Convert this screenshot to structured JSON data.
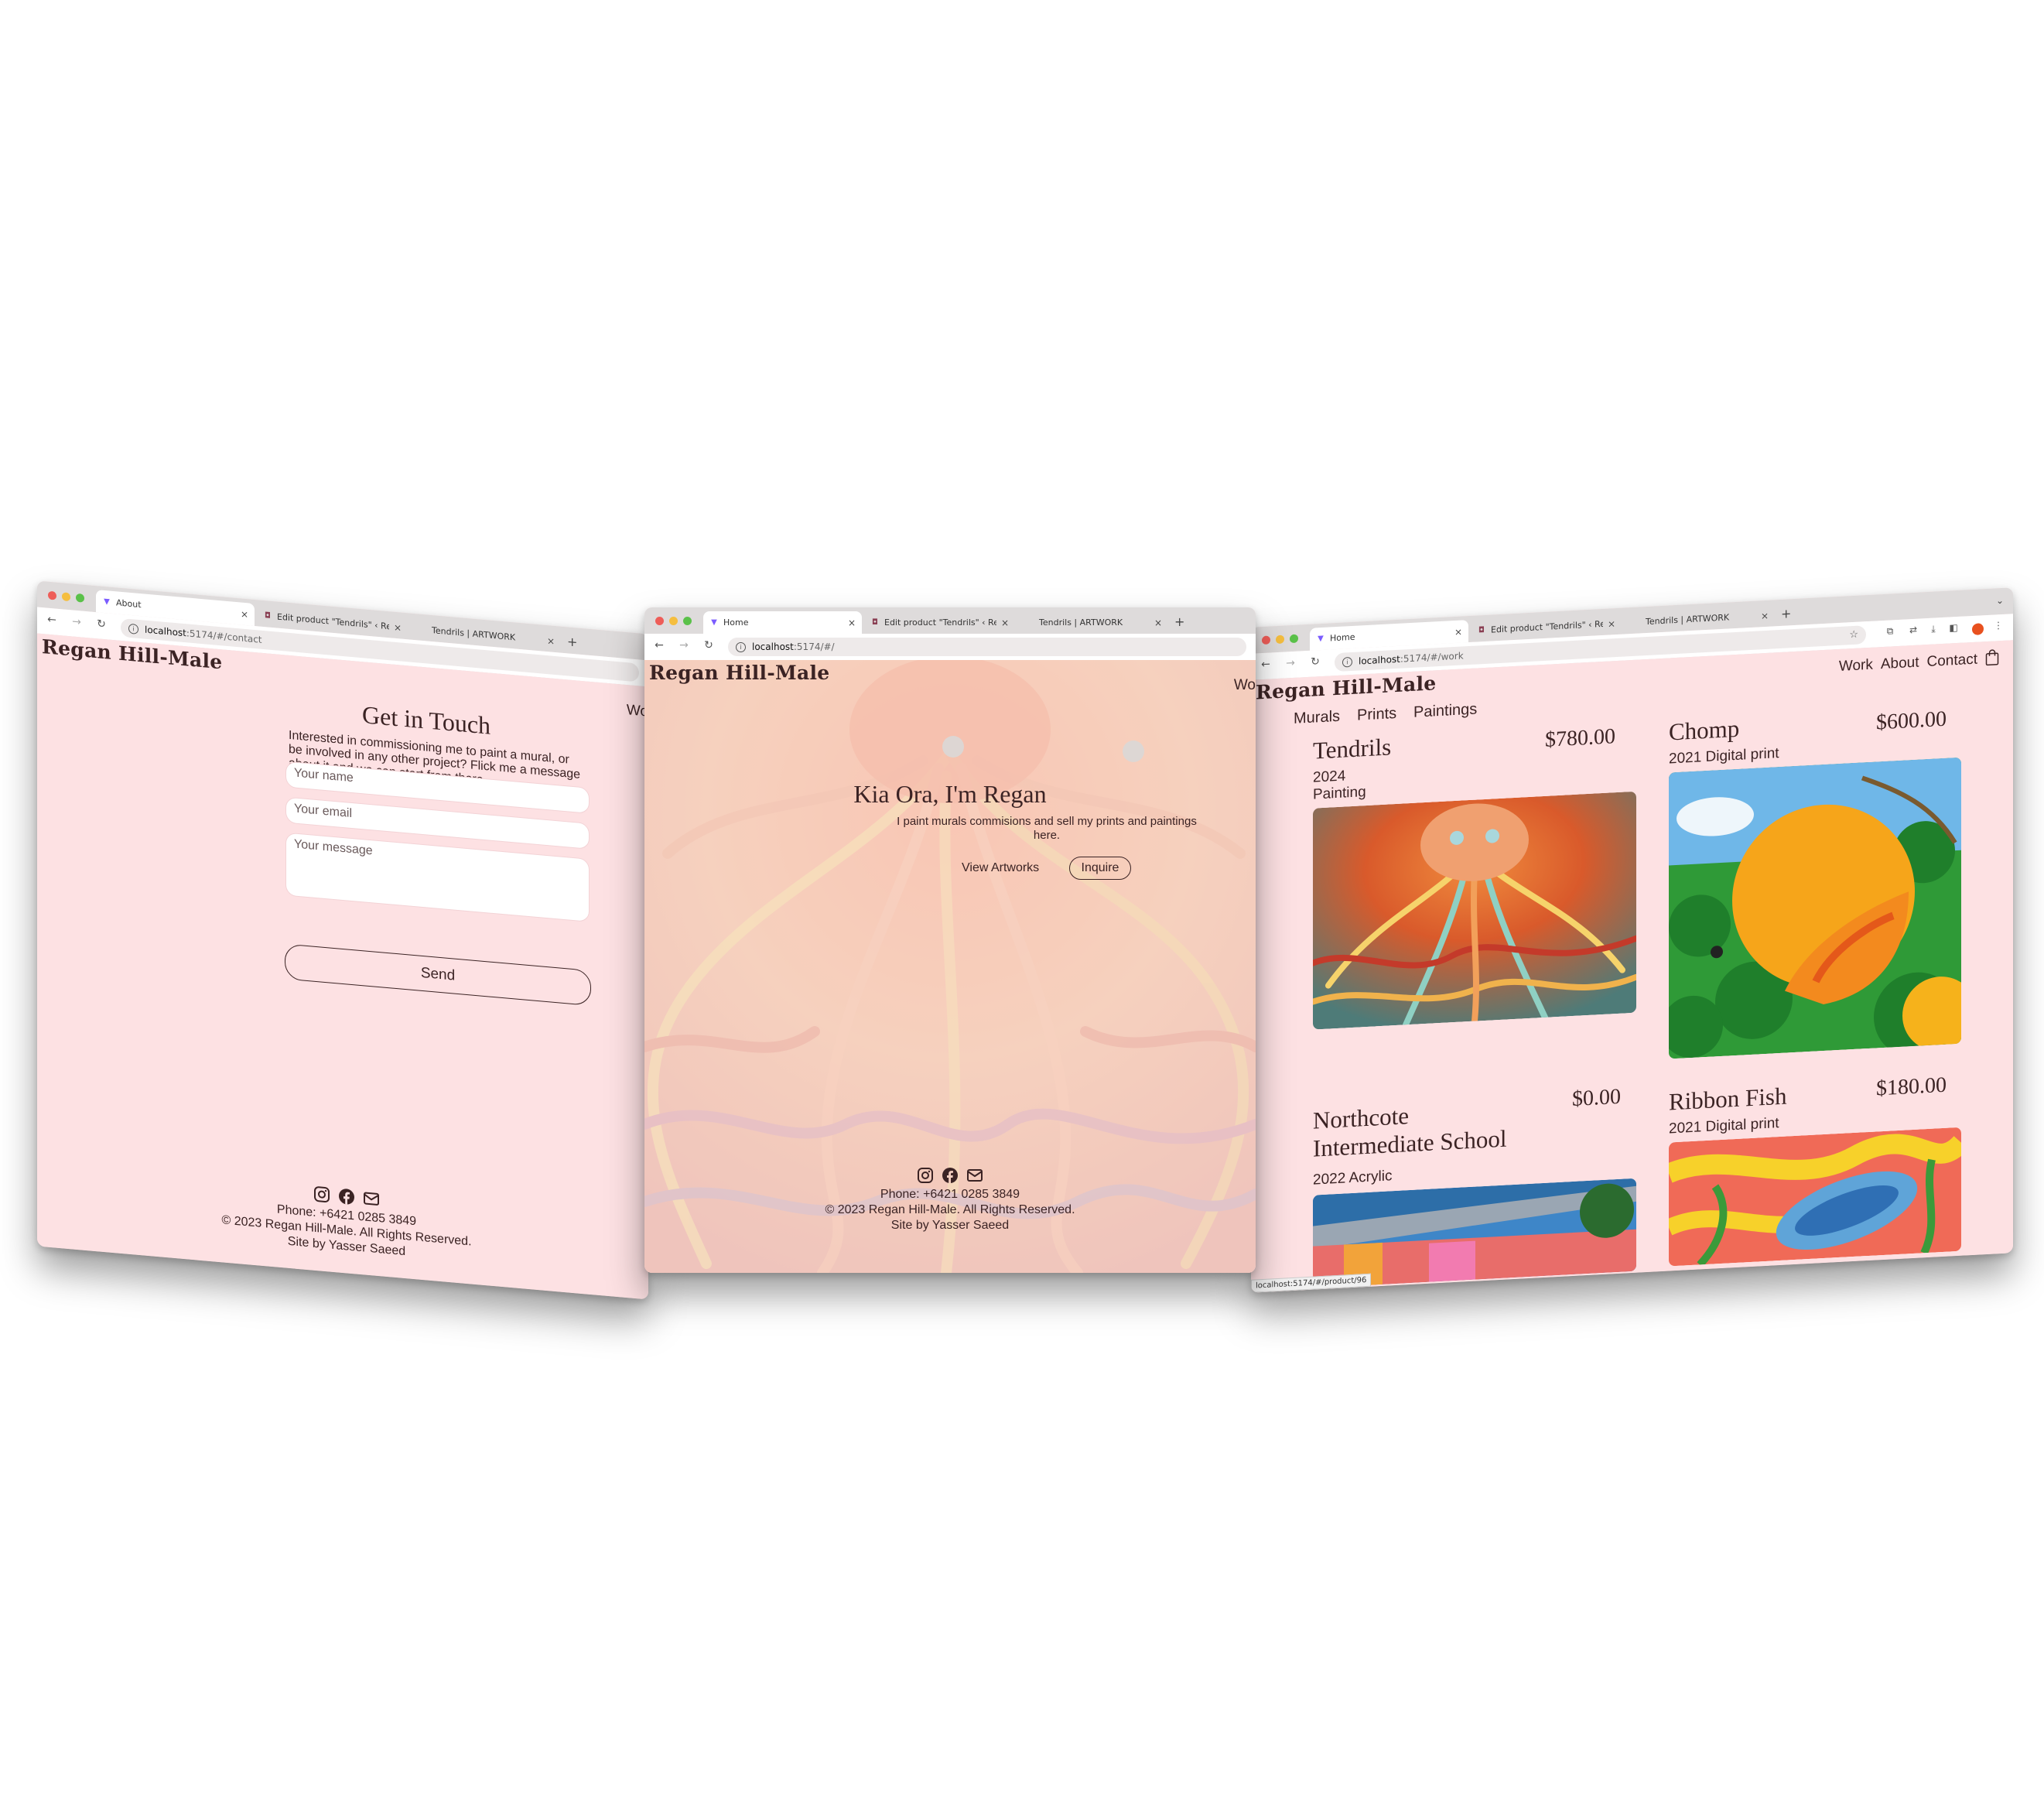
{
  "tabs": {
    "about": "About",
    "home": "Home",
    "edit": "Edit product \"Tendrils\" ‹ Rega",
    "tendrils": "Tendrils | ARTWORK",
    "plus": "+",
    "close": "×"
  },
  "urls": {
    "host": "localhost",
    "contact_path": ":5174/#/contact",
    "home_path": ":5174/#/",
    "work_path": ":5174/#/work"
  },
  "brand": "Regan Hill-Male",
  "nav": {
    "work": "Work",
    "about": "About",
    "contact": "Contact",
    "work_truncated": "Wo"
  },
  "contact": {
    "title": "Get in Touch",
    "intro": "Interested in commissioning me to paint a mural, or be involved in any other project? Flick me a message about it and we can start from there.",
    "name_placeholder": "Your name",
    "email_placeholder": "Your email",
    "message_placeholder": "Your message",
    "send": "Send"
  },
  "home": {
    "title": "Kia Ora, I'm Regan",
    "subtitle": "I paint murals commisions and sell my prints and paintings here.",
    "view": "View Artworks",
    "inquire": "Inquire"
  },
  "footer": {
    "phone": "Phone: +6421 0285 3849",
    "copyright": "© 2023 Regan Hill-Male. All Rights Reserved.",
    "credit": "Site by Yasser Saeed"
  },
  "work": {
    "filters": [
      "Murals",
      "Prints",
      "Paintings"
    ],
    "products": [
      {
        "title": "Tendrils",
        "price": "$780.00",
        "year": "2024",
        "medium": "Painting"
      },
      {
        "title": "Chomp",
        "price": "$600.00",
        "meta": "2021 Digital print"
      },
      {
        "title_line1": "Northcote",
        "title_line2": "Intermediate School",
        "price": "$0.00",
        "meta": "2022 Acrylic"
      },
      {
        "title": "Ribbon Fish",
        "price": "$180.00",
        "meta": "2021 Digital print"
      }
    ],
    "status_url": "localhost:5174/#/product/96"
  },
  "colors": {
    "page_bg": "#fde1e3",
    "ink": "#3b2324",
    "chrome": "#dedbdb"
  }
}
